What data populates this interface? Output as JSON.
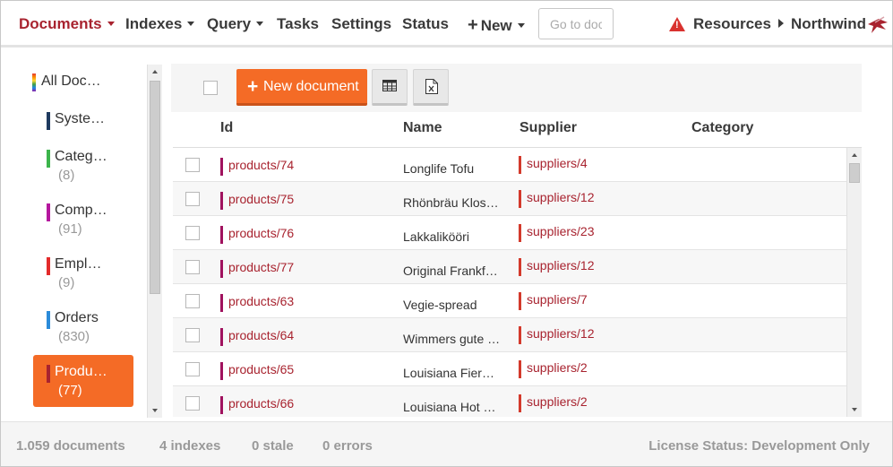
{
  "nav": {
    "documents": "Documents",
    "indexes": "Indexes",
    "query": "Query",
    "tasks": "Tasks",
    "settings": "Settings",
    "status": "Status",
    "new": "New",
    "new_icon": "plus-icon",
    "goto_placeholder": "Go to doc",
    "resources": "Resources",
    "database": "Northwind",
    "warning_icon": "warning-triangle-icon",
    "active_color": "#a8232f"
  },
  "sidebar": {
    "all_documents": "All Doc…",
    "items": [
      {
        "label": "Syste…",
        "count": "",
        "color": "#1f3a5f"
      },
      {
        "label": "Categ…",
        "count": "(8)",
        "color": "#3cb44b"
      },
      {
        "label": "Comp…",
        "count": "(91)",
        "color": "#b5179e"
      },
      {
        "label": "Empl…",
        "count": "(9)",
        "color": "#e32b2b"
      },
      {
        "label": "Orders",
        "count": "(830)",
        "color": "#2b8bd9"
      },
      {
        "label": "Produ…",
        "count": "(77)",
        "color": "#a8232f",
        "active": true
      }
    ]
  },
  "toolbar": {
    "new_document_label": "New document",
    "accent": "#f46b26",
    "table_icon": "table-icon",
    "excel_icon": "excel-export-icon"
  },
  "columns": [
    "Id",
    "Name",
    "Supplier",
    "Category"
  ],
  "rows": [
    {
      "id": "products/74",
      "name": "Longlife Tofu",
      "supplier": "suppliers/4"
    },
    {
      "id": "products/75",
      "name": "Rhönbräu Klos…",
      "supplier": "suppliers/12"
    },
    {
      "id": "products/76",
      "name": "Lakkalikööri",
      "supplier": "suppliers/23"
    },
    {
      "id": "products/77",
      "name": "Original Frankf…",
      "supplier": "suppliers/12"
    },
    {
      "id": "products/63",
      "name": "Vegie-spread",
      "supplier": "suppliers/7"
    },
    {
      "id": "products/64",
      "name": "Wimmers gute …",
      "supplier": "suppliers/12"
    },
    {
      "id": "products/65",
      "name": "Louisiana Fier…",
      "supplier": "suppliers/2"
    },
    {
      "id": "products/66",
      "name": "Louisiana Hot …",
      "supplier": "suppliers/2"
    }
  ],
  "footer": {
    "documents": "1.059 documents",
    "indexes": "4 indexes",
    "stale": "0 stale",
    "errors": "0 errors",
    "license": "License Status: Development Only"
  }
}
